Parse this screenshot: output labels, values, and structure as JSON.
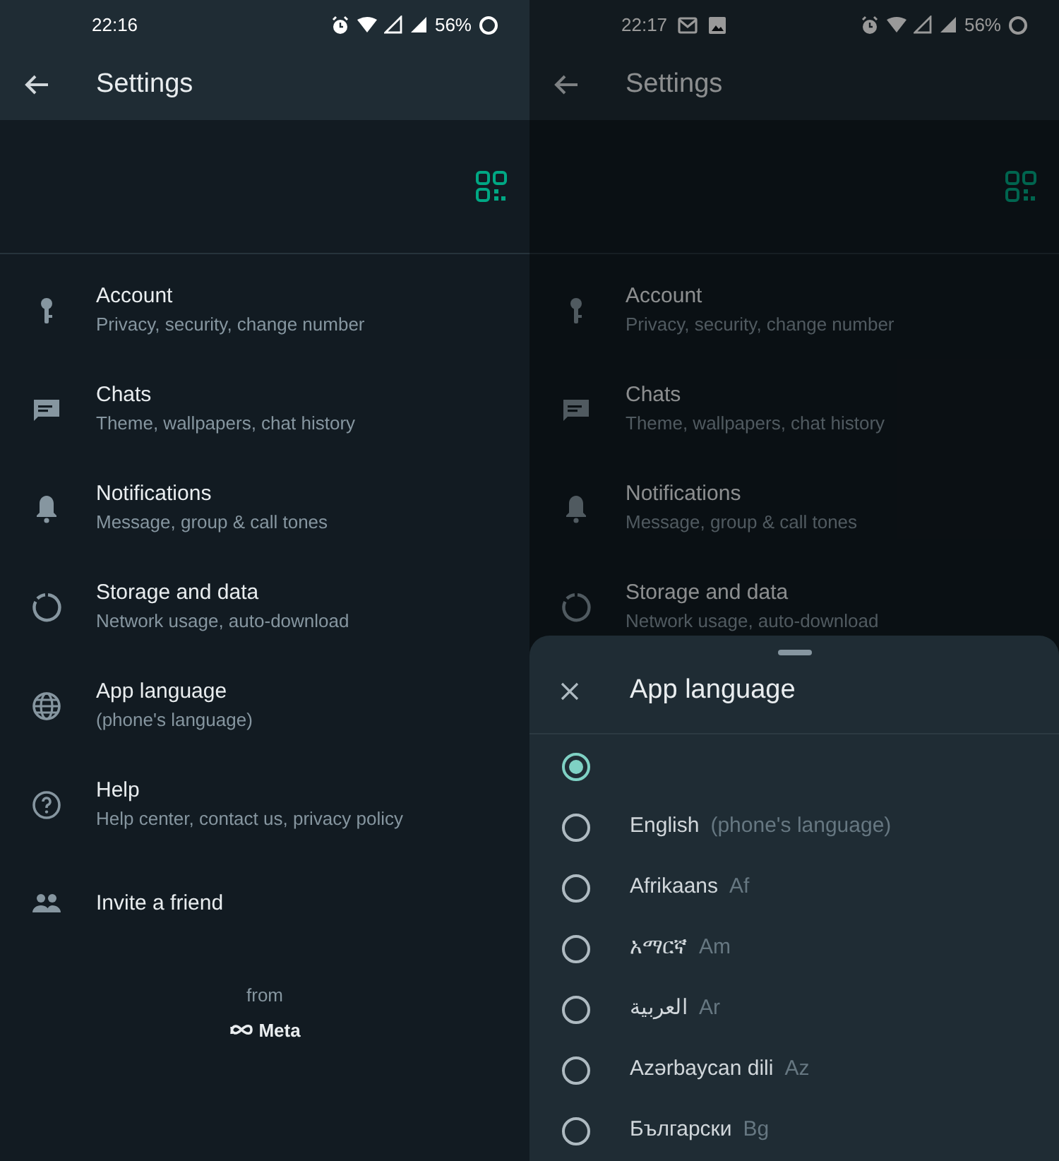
{
  "screens": [
    {
      "status_bar": {
        "time": "22:16",
        "battery": "56%"
      },
      "app_bar": {
        "title": "Settings"
      },
      "dimmed": false,
      "items": [
        {
          "title": "Account",
          "subtitle": "Privacy, security, change number"
        },
        {
          "title": "Chats",
          "subtitle": "Theme, wallpapers, chat history"
        },
        {
          "title": "Notifications",
          "subtitle": "Message, group & call tones"
        },
        {
          "title": "Storage and data",
          "subtitle": "Network usage, auto-download"
        },
        {
          "title": "App language",
          "subtitle": "(phone's language)"
        },
        {
          "title": "Help",
          "subtitle": "Help center, contact us, privacy policy"
        },
        {
          "title": "Invite a friend"
        }
      ],
      "footer": {
        "from": "from",
        "brand": "Meta"
      }
    },
    {
      "status_bar": {
        "time": "22:17",
        "battery": "56%"
      },
      "app_bar": {
        "title": "Settings"
      },
      "dimmed": true,
      "items": [
        {
          "title": "Account",
          "subtitle": "Privacy, security, change number"
        },
        {
          "title": "Chats",
          "subtitle": "Theme, wallpapers, chat history"
        },
        {
          "title": "Notifications",
          "subtitle": "Message, group & call tones"
        },
        {
          "title": "Storage and data",
          "subtitle": "Network usage, auto-download"
        }
      ],
      "sheet": {
        "title": "App language",
        "options": [
          {
            "selected": true
          },
          {
            "label": "English",
            "code": "(phone's language)",
            "selected": false
          },
          {
            "label": "Afrikaans",
            "code": "Af",
            "selected": false
          },
          {
            "label": "አማርኛ",
            "code": "Am",
            "selected": false
          },
          {
            "label": "العربية",
            "code": "Ar",
            "selected": false
          },
          {
            "label": "Azərbaycan dili",
            "code": "Az",
            "selected": false
          },
          {
            "label": "Български",
            "code": "Bg",
            "selected": false
          }
        ]
      }
    }
  ]
}
